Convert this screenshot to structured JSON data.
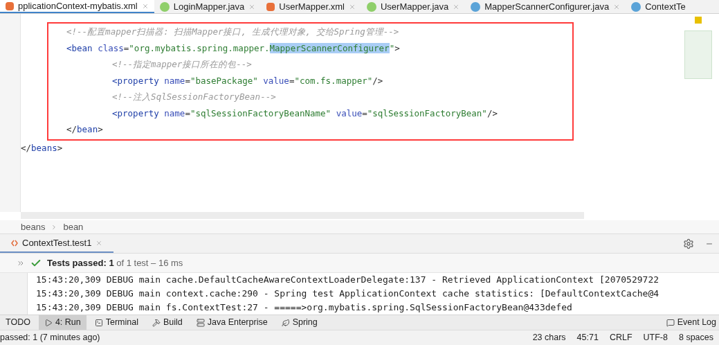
{
  "tabs": [
    {
      "label": "pplicationContext-mybatis.xml",
      "kind": "xml",
      "selected": true
    },
    {
      "label": "LoginMapper.java",
      "kind": "interface",
      "selected": false
    },
    {
      "label": "UserMapper.xml",
      "kind": "xml",
      "selected": false
    },
    {
      "label": "UserMapper.java",
      "kind": "interface",
      "selected": false
    },
    {
      "label": "MapperScannerConfigurer.java",
      "kind": "class",
      "selected": false
    },
    {
      "label": "ContextTe",
      "kind": "class",
      "selected": false
    }
  ],
  "editor": {
    "lines": [
      {
        "kind": "frame",
        "children": [
          {
            "kind": "line",
            "tokens": [
              {
                "kind": "comment",
                "text": "<!--配置mapper扫描器: 扫描Mapper接口, 生成代理对象, 交给Spring管理-->"
              }
            ]
          },
          {
            "kind": "line",
            "tokens": [
              {
                "kind": "tag",
                "text": "<bean "
              },
              {
                "kind": "attr",
                "text": "class"
              },
              {
                "kind": "plain",
                "text": "="
              },
              {
                "kind": "value",
                "text": "\"org.mybatis.spring.mapper."
              },
              {
                "kind": "match",
                "text": "MapperScannerConfigurer"
              },
              {
                "kind": "value",
                "text": "\""
              },
              {
                "kind": "plain",
                "text": ">"
              }
            ],
            "children": [
              {
                "kind": "line",
                "tokens": [
                  {
                    "kind": "comment",
                    "text": "<!--指定mapper接口所在的包-->"
                  }
                ]
              },
              {
                "kind": "line",
                "tokens": [
                  {
                    "kind": "tag",
                    "text": "<property "
                  },
                  {
                    "kind": "attr",
                    "text": "name"
                  },
                  {
                    "kind": "plain",
                    "text": "="
                  },
                  {
                    "kind": "value",
                    "text": "\"basePackage\" "
                  },
                  {
                    "kind": "attr",
                    "text": "value"
                  },
                  {
                    "kind": "plain",
                    "text": "="
                  },
                  {
                    "kind": "value",
                    "text": "\"com.fs.mapper\""
                  },
                  {
                    "kind": "plain",
                    "text": "/>"
                  }
                ]
              },
              {
                "kind": "line",
                "tokens": [
                  {
                    "kind": "comment",
                    "text": "<!--注入SqlSessionFactoryBean-->"
                  }
                ]
              },
              {
                "kind": "line",
                "tokens": [
                  {
                    "kind": "tag",
                    "text": "<property "
                  },
                  {
                    "kind": "attr",
                    "text": "name"
                  },
                  {
                    "kind": "plain",
                    "text": "="
                  },
                  {
                    "kind": "value",
                    "text": "\"sqlSessionFactoryBeanName\" "
                  },
                  {
                    "kind": "attr",
                    "text": "value"
                  },
                  {
                    "kind": "plain",
                    "text": "="
                  },
                  {
                    "kind": "value",
                    "text": "\"sqlSessionFactoryBean\""
                  },
                  {
                    "kind": "plain",
                    "text": "/>"
                  }
                ]
              }
            ]
          },
          {
            "kind": "line",
            "tokens": [
              {
                "kind": "plain",
                "text": "</"
              },
              {
                "kind": "tag",
                "text": "bean"
              },
              {
                "kind": "plain",
                "text": ">"
              }
            ]
          }
        ]
      },
      {
        "kind": "line",
        "tokens": [
          {
            "kind": "plain",
            "text": "</"
          },
          {
            "kind": "tag",
            "text": "beans"
          },
          {
            "kind": "plain",
            "text": ">"
          }
        ]
      }
    ]
  },
  "breadcrumbs": [
    "beans",
    "bean"
  ],
  "run_panel": {
    "tab": "ContextTest.test1",
    "summary_label": "Tests passed:",
    "summary_count": "1",
    "summary_rest": "of 1 test – 16 ms",
    "log": [
      "15:43:20,309 DEBUG main cache.DefaultCacheAwareContextLoaderDelegate:137 - Retrieved ApplicationContext [2070529722",
      "15:43:20,309 DEBUG main context.cache:290 - Spring test ApplicationContext cache statistics: [DefaultContextCache@4",
      "15:43:20,309 DEBUG main fs.ContextTest:27 - =====>org.mybatis.spring.SqlSessionFactoryBean@433defed"
    ]
  },
  "tool_windows": [
    {
      "label": "TODO",
      "kind": "plain",
      "selected": false
    },
    {
      "label": "4: Run",
      "kind": "run",
      "selected": true
    },
    {
      "label": "Terminal",
      "kind": "terminal",
      "selected": false
    },
    {
      "label": "Build",
      "kind": "build",
      "selected": false
    },
    {
      "label": "Java Enterprise",
      "kind": "enterprise",
      "selected": false
    },
    {
      "label": "Spring",
      "kind": "spring",
      "selected": false
    }
  ],
  "event_log": "Event Log",
  "status_bar": {
    "message": "passed: 1 (7 minutes ago)",
    "items": [
      "23 chars",
      "45:71",
      "CRLF",
      "UTF-8",
      "8 spaces"
    ]
  }
}
